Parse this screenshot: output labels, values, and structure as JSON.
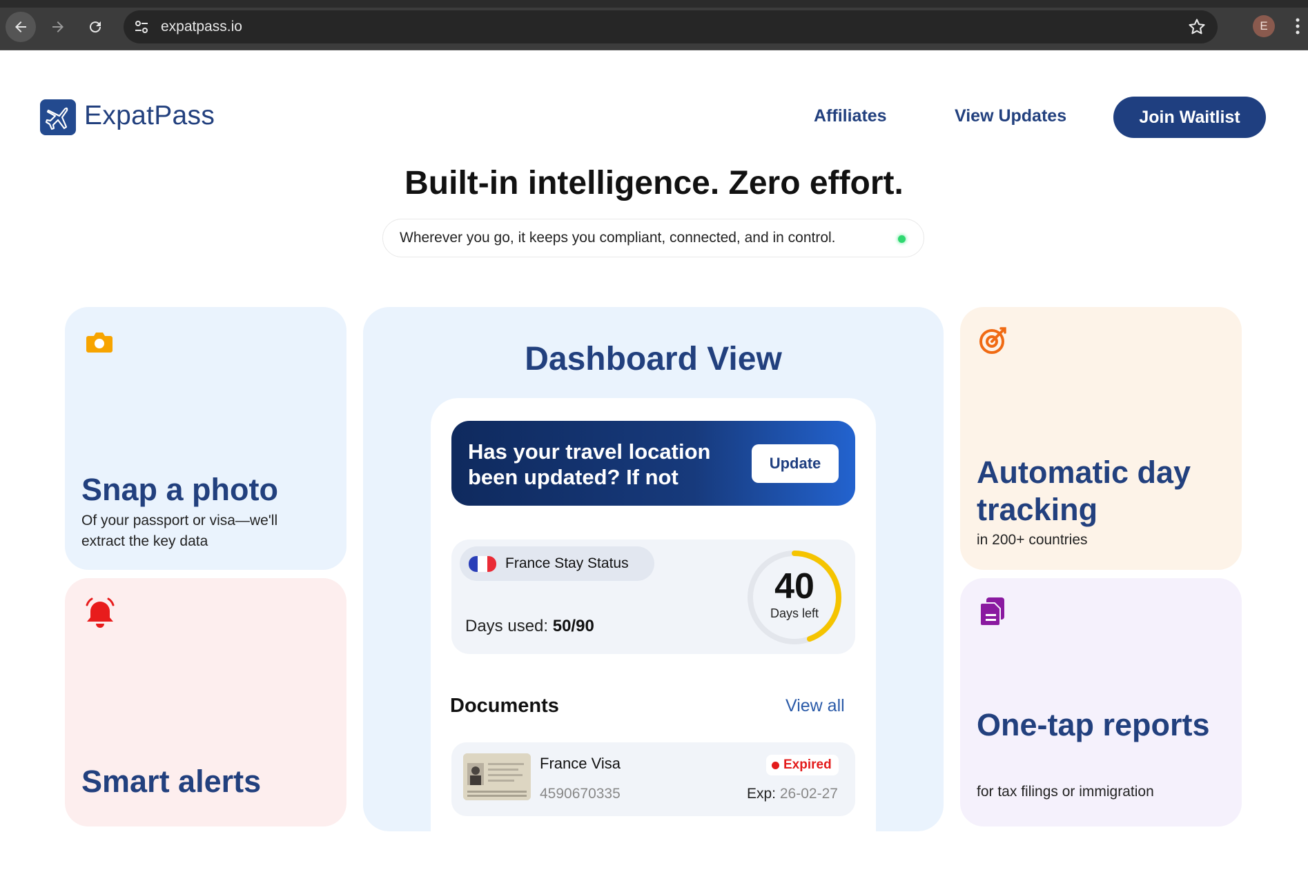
{
  "browser": {
    "url": "expatpass.io",
    "profile_initial": "E",
    "icons": [
      "back-icon",
      "forward-icon",
      "reload-icon",
      "site-settings-icon",
      "bookmark-star-icon",
      "more-menu-icon"
    ]
  },
  "header": {
    "brand": "ExpatPass",
    "nav": [
      "Affiliates",
      "View Updates"
    ],
    "cta": "Join Waitlist"
  },
  "hero": {
    "title": "Built-in intelligence. Zero effort.",
    "subtitle": "Wherever you go, it keeps you compliant, connected, and in control."
  },
  "features": {
    "snap": {
      "title": "Snap a photo",
      "desc": "Of your passport or visa—we'll extract the key data",
      "icon": "camera-icon"
    },
    "alerts": {
      "title": "Smart alerts",
      "icon": "bell-icon"
    },
    "tracking": {
      "title": "Automatic day tracking",
      "desc": "in 200+ countries",
      "icon": "target-icon"
    },
    "reports": {
      "title": "One-tap reports",
      "desc": "for tax filings or immigration",
      "icon": "document-icon"
    }
  },
  "dashboard": {
    "title": "Dashboard View",
    "banner": {
      "text": "Has your travel location been updated? If not",
      "button": "Update"
    },
    "stay": {
      "country": "France Stay Status",
      "days_used_label": "Days used:",
      "days_used_value": "50/90",
      "days_left": "40",
      "days_left_label": "Days left",
      "progress_fraction": 0.444
    },
    "documents": {
      "title": "Documents",
      "view_all": "View all",
      "items": [
        {
          "name": "France Visa",
          "number": "4590670335",
          "status": "Expired",
          "exp_label": "Exp:",
          "exp_date": "26-02-27"
        }
      ]
    }
  },
  "colors": {
    "brand": "#22407e",
    "cta": "#1f3f80",
    "ring": "#f5c400",
    "expired": "#e31b1b"
  }
}
